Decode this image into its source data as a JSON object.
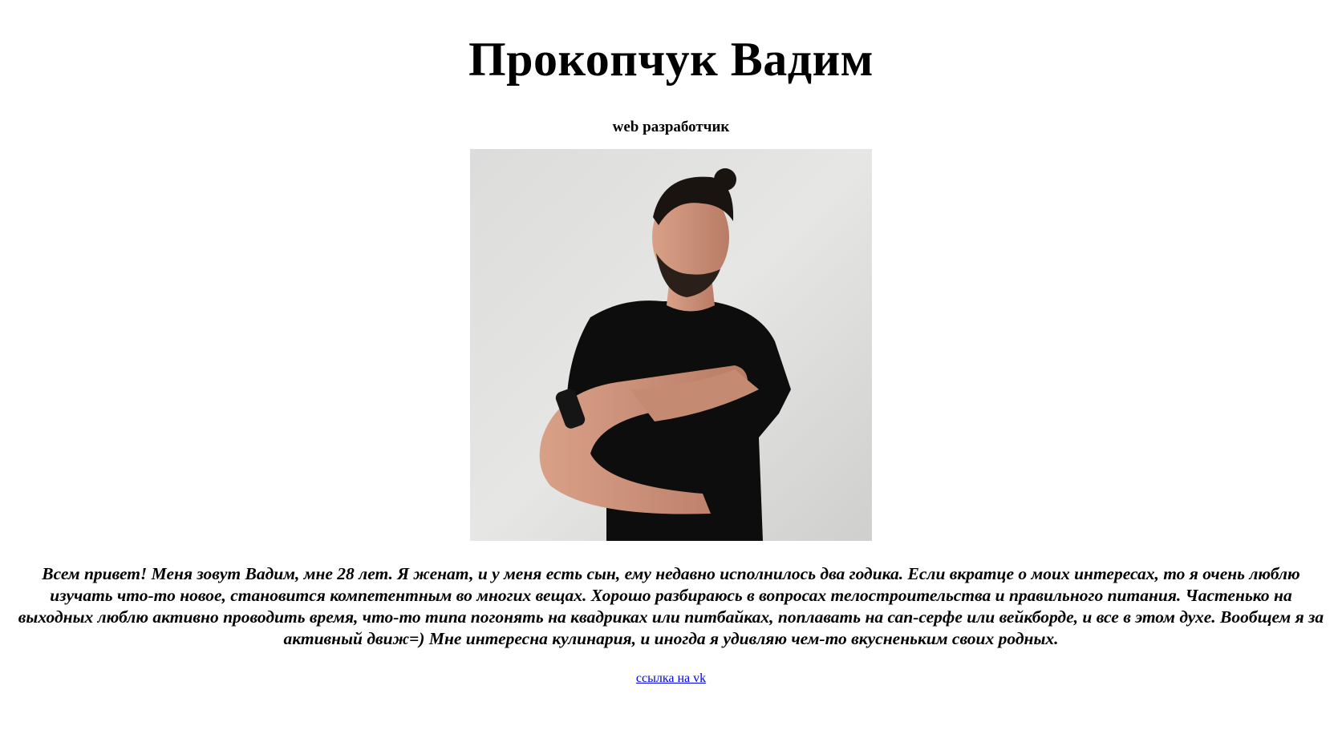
{
  "header": {
    "name": "Прокопчук Вадим",
    "role": "web разработчик"
  },
  "profile_photo": {
    "icon": "profile-photo"
  },
  "about": {
    "text": "Всем привет! Меня зовут Вадим, мне 28 лет. Я женат, и у меня есть сын, ему недавно исполнилось два годика. Если вкратце о моих интересах, то я очень люблю изучать что-то новое, становится компетентным во многих вещах. Хорошо разбираюсь в вопросах телостроительства и правильного питания. Частенько на выходных люблю активно проводить время, что-то типа погонять на квадриках или питбайках, поплавать на сап-серфе или вейкборде, и все в этом духе. Вообщем я за активный движ=) Мне интересна кулинария, и иногда я удивляю чем-то вкусненьким своих родных."
  },
  "links": {
    "vk_label": "ссылка на vk"
  },
  "colors": {
    "background": "#ffffff",
    "text": "#000000",
    "link": "#0000ee",
    "photo_wall": "#d9d9d7",
    "shirt": "#0d0d0d"
  }
}
